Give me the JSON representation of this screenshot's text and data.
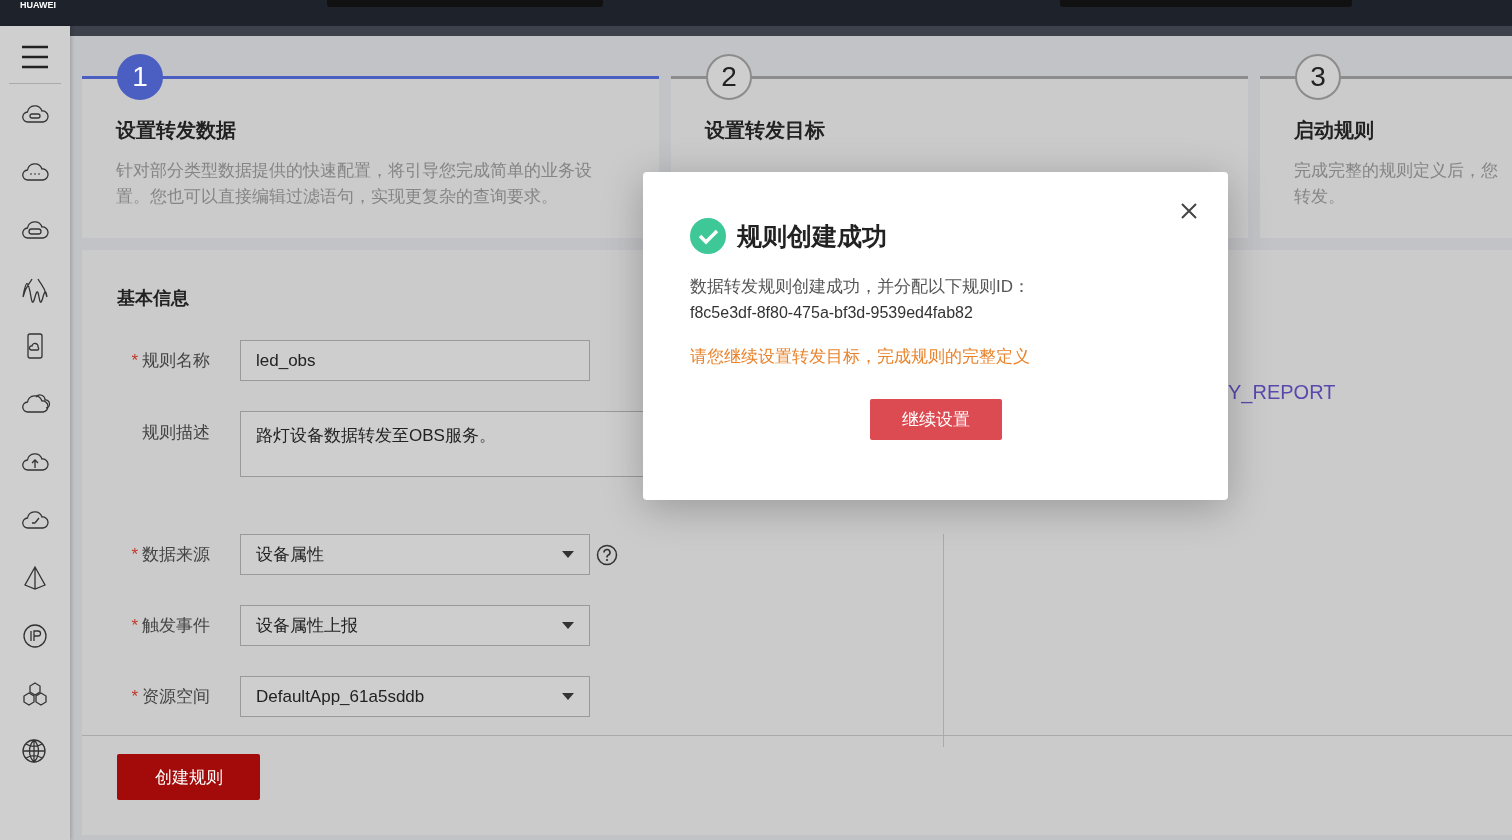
{
  "top_bar": {
    "brand": "HUAWEI"
  },
  "steps": [
    {
      "number": "1",
      "title": "设置转发数据",
      "description_lines": [
        "针对部分类型数据提供的快速配置，将引导您完成简单的业务设",
        "置。您也可以直接编辑过滤语句，实现更复杂的查询要求。"
      ],
      "selected": true
    },
    {
      "number": "2",
      "title": "设置转发目标",
      "selected": false
    },
    {
      "number": "3",
      "title": "启动规则",
      "description_lines": [
        "完成完整的规则定义后，您",
        "转发。"
      ],
      "selected": false
    }
  ],
  "form": {
    "section_title": "基本信息",
    "fields": [
      {
        "kind": "input",
        "marker": "*",
        "label": "规则名称",
        "value": "led_obs"
      },
      {
        "kind": "textarea",
        "label": "规则描述",
        "value": "路灯设备数据转发至OBS服务。"
      },
      {
        "kind": "select",
        "marker": "*",
        "label": "数据来源",
        "value": "设备属性",
        "help": true
      },
      {
        "kind": "select",
        "marker": "*",
        "label": "触发事件",
        "value": "设备属性上报"
      },
      {
        "kind": "select",
        "marker": "*",
        "label": "资源空间",
        "value": "DefaultApp_61a5sddb"
      }
    ],
    "submit": "创建规则"
  },
  "right_panel": {
    "text": "Y_REPORT"
  },
  "dialog": {
    "title": "规则创建成功",
    "message": "数据转发规则创建成功，并分配以下规则ID：",
    "rule_id": "f8c5e3df-8f80-475a-bf3d-9539ed4fab82",
    "hint": "请您继续设置转发目标，完成规则的完整定义",
    "button": "继续设置"
  }
}
